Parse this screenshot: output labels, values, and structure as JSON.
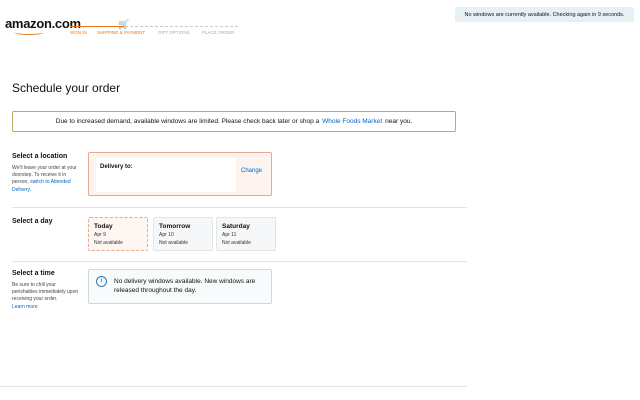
{
  "header": {
    "logo_text": "amazon.com",
    "progress": {
      "steps": [
        "SIGN IN",
        "SHIPPING & PAYMENT",
        "GIFT OPTIONS",
        "PLACE ORDER"
      ],
      "active_step_count": 2,
      "cart_icon": "shopping-cart-icon"
    }
  },
  "status_banner": "No windows are currently available. Checking again in 9 seconds.",
  "page_title": "Schedule your order",
  "alert": {
    "text_before": "Due to increased demand, available windows are limited. Please check back later or shop a",
    "link": "Whole Foods Market",
    "text_after": "near you."
  },
  "location": {
    "heading": "Select a location",
    "desc_before": "We'll leave your order at your doorstep. To receive it in person,",
    "desc_link": "switch to Attended Delivery.",
    "delivery_label": "Delivery to:",
    "change": "Change"
  },
  "day": {
    "heading": "Select a day",
    "options": [
      {
        "name": "Today",
        "date": "Apr 9",
        "status": "Not available",
        "selected": true
      },
      {
        "name": "Tomorrow",
        "date": "Apr 10",
        "status": "Not available",
        "selected": false
      },
      {
        "name": "Saturday",
        "date": "Apr 11",
        "status": "Not available",
        "selected": false
      }
    ]
  },
  "time": {
    "heading": "Select a time",
    "desc": "Be sure to chill your perishables immediately upon receiving your order.",
    "learn_more": "Learn more",
    "info_icon": "info-icon",
    "info_text": "No delivery windows available. New windows are released throughout the day."
  },
  "colors": {
    "accent_orange": "#e47911",
    "link_blue": "#0066c0",
    "banner_bg": "#e6f0f5",
    "alert_border": "#c7a66a"
  }
}
